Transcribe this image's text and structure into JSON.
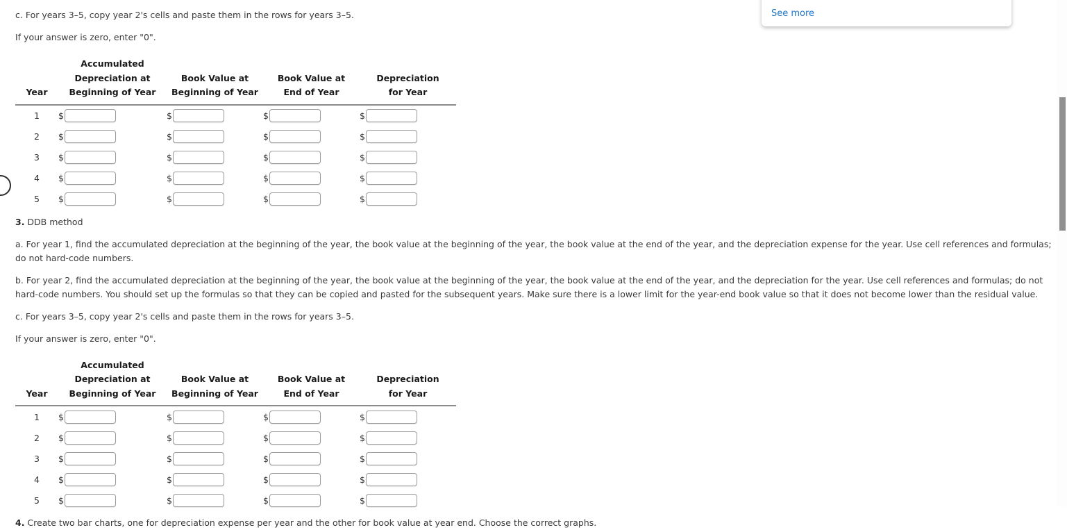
{
  "overlay": {
    "see_more_label": "See more"
  },
  "blocks": {
    "top_c": "c. For years 3–5, copy year 2's cells and paste them in the rows for years 3–5.",
    "top_zero": "If your answer is zero, enter \"0\".",
    "ddb_heading_num": "3.",
    "ddb_heading_text": " DDB method",
    "ddb_a": "a. For year 1, find the accumulated depreciation at the beginning of the year, the book value at the beginning of the year, the book value at the end of the year, and the depreciation expense for the year. Use cell references and formulas; do not hard-code numbers.",
    "ddb_b": "b. For year 2, find the accumulated depreciation at the beginning of the year, the book value at the beginning of the year, the book value at the end of the year, and the depreciation for the year. Use cell references and formulas; do not hard-code numbers. You should set up the formulas so that they can be copied and pasted for the subsequent years. Make sure there is a lower limit for the year-end book value so that it does not become lower than the residual value.",
    "ddb_c": "c. For years 3–5, copy year 2's cells and paste them in the rows for years 3–5.",
    "ddb_zero": "If your answer is zero, enter \"0\".",
    "item4_num": "4.",
    "item4_text": " Create two bar charts, one for depreciation expense per year and the other for book value at year end. Choose the correct graphs."
  },
  "table": {
    "headers": {
      "year": "Year",
      "accum_dep_begin": "Accumulated Depreciation at Beginning of Year",
      "book_value_begin": "Book Value at Beginning of Year",
      "book_value_end": "Book Value at End of Year",
      "depreciation_for_year": "Depreciation for Year"
    },
    "header_lines": {
      "year": [
        "Year"
      ],
      "accum_dep_begin": [
        "Accumulated",
        "Depreciation at",
        "Beginning of Year"
      ],
      "book_value_begin": [
        "Book Value at",
        "Beginning of Year"
      ],
      "book_value_end": [
        "Book Value at",
        "End of Year"
      ],
      "depreciation_for_year": [
        "Depreciation",
        "for Year"
      ]
    },
    "currency_symbol": "$",
    "rows": [
      {
        "year": "1",
        "accum_dep_begin": "",
        "book_value_begin": "",
        "book_value_end": "",
        "depreciation_for_year": ""
      },
      {
        "year": "2",
        "accum_dep_begin": "",
        "book_value_begin": "",
        "book_value_end": "",
        "depreciation_for_year": ""
      },
      {
        "year": "3",
        "accum_dep_begin": "",
        "book_value_begin": "",
        "book_value_end": "",
        "depreciation_for_year": ""
      },
      {
        "year": "4",
        "accum_dep_begin": "",
        "book_value_begin": "",
        "book_value_end": "",
        "depreciation_for_year": ""
      },
      {
        "year": "5",
        "accum_dep_begin": "",
        "book_value_begin": "",
        "book_value_end": "",
        "depreciation_for_year": ""
      }
    ]
  },
  "colors": {
    "link": "#1d76c7",
    "text": "#333333",
    "rule": "#8a8a8a",
    "input_border": "#9a9a9a",
    "scrollbar_thumb": "#909090",
    "background": "#ffffff"
  }
}
